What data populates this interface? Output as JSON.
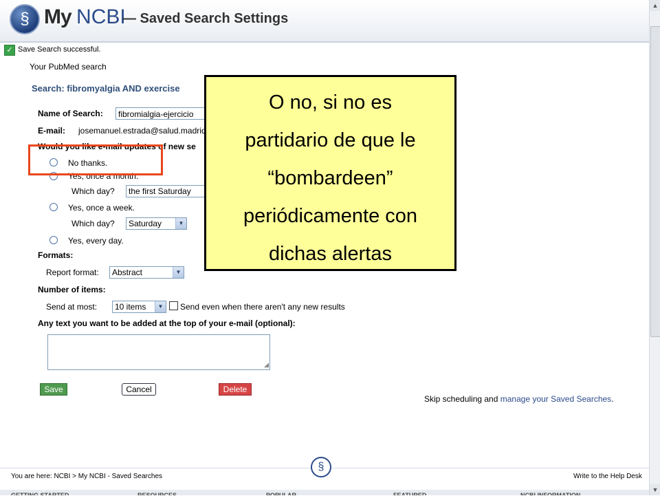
{
  "header": {
    "brand_my": "My",
    "brand_ncbi": "NCBI",
    "title": "— Saved Search Settings"
  },
  "status": {
    "message": "Save Search successful.",
    "context": "Your PubMed search",
    "search_label": "Search: fibromyalgia AND exercise"
  },
  "form": {
    "name_label": "Name of Search:",
    "name_value": "fibromialgia-ejercicio",
    "email_label": "E-mail:",
    "email_value": "josemanuel.estrada@salud.madrid",
    "updates_question": "Would you like e-mail updates of new se",
    "options": {
      "no_thanks": "No thanks.",
      "monthly": "Yes, once a month.",
      "weekly": "Yes, once a week.",
      "daily": "Yes, every day."
    },
    "which_day_label": "Which day?",
    "monthly_day": "the first Saturday",
    "weekly_day": "Saturday",
    "formats_label": "Formats:",
    "report_format_label": "Report format:",
    "report_format_value": "Abstract",
    "number_items_label": "Number of items:",
    "send_at_most_label": "Send at most:",
    "send_at_most_value": "10 items",
    "send_even_label": "Send even when there aren't any new results",
    "text_label": "Any text you want to be added at the top of your e-mail (optional):",
    "text_value": ""
  },
  "buttons": {
    "save": "Save",
    "cancel": "Cancel",
    "delete": "Delete"
  },
  "skip": {
    "prefix": "Skip scheduling and ",
    "link": "manage your Saved Searches",
    "suffix": "."
  },
  "footer": {
    "breadcrumb": "You are here: NCBI > My NCBI - Saved Searches",
    "help": "Write to the Help Desk",
    "nav": [
      "GETTING STARTED",
      "RESOURCES",
      "POPULAR",
      "FEATURED",
      "NCBI INFORMATION"
    ]
  },
  "callout": {
    "lines": [
      "O no, si no es",
      "partidario de que le",
      "“bombardeen”",
      "periódicamente con",
      "dichas alertas"
    ]
  },
  "colors": {
    "highlight_border": "#e8471d",
    "callout_bg": "#ffff99",
    "save_btn": "#4f9a4f",
    "delete_btn": "#d64545"
  }
}
